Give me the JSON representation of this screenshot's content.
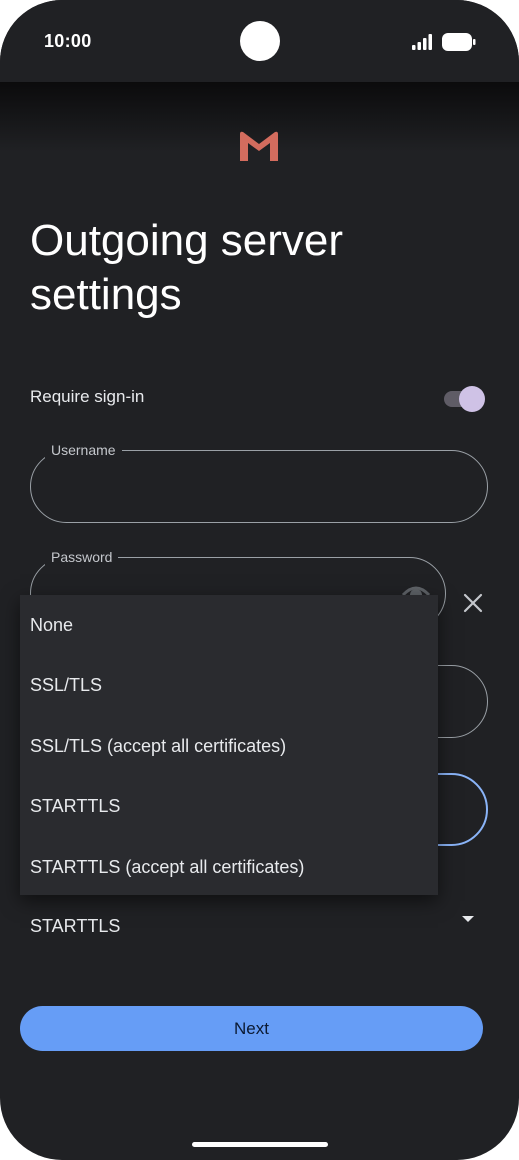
{
  "status_bar": {
    "time": "10:00"
  },
  "page": {
    "title": "Outgoing server settings"
  },
  "require_sign_in": {
    "label": "Require sign-in",
    "enabled": true
  },
  "fields": {
    "username": {
      "label": "Username",
      "value": ""
    },
    "password": {
      "label": "Password",
      "value": ""
    }
  },
  "security_dropdown": {
    "selected": "STARTTLS",
    "options": [
      "None",
      "SSL/TLS",
      "SSL/TLS (accept all certificates)",
      "STARTTLS",
      "STARTTLS (accept all certificates)"
    ]
  },
  "actions": {
    "next_label": "Next"
  },
  "icons": [
    "mail-logo-icon",
    "signal-icon",
    "battery-icon",
    "eye-icon",
    "close-icon",
    "dropdown-arrow-icon"
  ],
  "colors": {
    "background": "#202124",
    "accent": "#669df6",
    "toggle_thumb": "#cfc2e6",
    "focus_border": "#8ab4f8"
  }
}
